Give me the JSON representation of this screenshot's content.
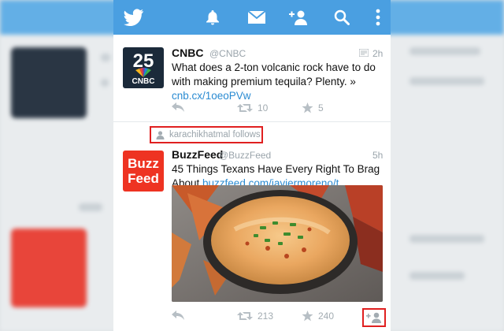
{
  "icons": {
    "twitter_logo": "bird-icon",
    "notifications": "bell-icon",
    "messages": "envelope-icon",
    "add_user": "add-user-icon",
    "search": "search-icon",
    "overflow": "more-vertical-icon"
  },
  "colors": {
    "topbar": "#4a9fe1",
    "link": "#2a8bd2",
    "highlight": "#e02020",
    "buzzfeed_red": "#ee3322",
    "cnbc_dark": "#1b2a3a"
  },
  "tweets": [
    {
      "name": "CNBC",
      "handle": "@CNBC",
      "time": "2h",
      "text": "What does a 2-ton volcanic rock have to do with making premium tequila? Plenty. »",
      "link": "cnb.cx/1oeoPVw",
      "avatar_text_top": "25",
      "avatar_text_bottom": "CNBC",
      "retweets": "10",
      "favorites": "5"
    },
    {
      "context": "karachikhatmal follows",
      "name": "BuzzFeed",
      "handle": "@BuzzFeed",
      "time": "5h",
      "text_line1": "45 Things Texans Have Every Right To Brag",
      "text_line2_prefix": "About ",
      "link": "buzzfeed.com/javiermoreno/t...",
      "avatar_text_top": "Buzz",
      "avatar_text_bottom": "Feed",
      "retweets": "213",
      "favorites": "240"
    }
  ]
}
